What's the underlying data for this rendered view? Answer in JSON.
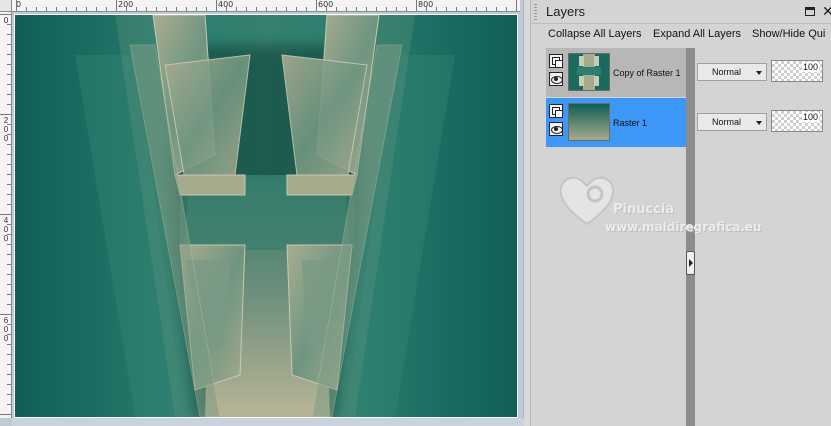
{
  "colors": {
    "teal_dark": "#0f5f55",
    "teal_mid": "#2b7f70",
    "sage": "#a6ab8d",
    "selection_blue": "#3d97f7"
  },
  "rulers": {
    "top_labels": [
      "0",
      "200",
      "400",
      "600",
      "800"
    ],
    "left_labels": [
      "0",
      "2\n0\n0",
      "4\n0\n0",
      "6\n0\n0"
    ]
  },
  "panel": {
    "title": "Layers",
    "window_icon": "window-icon",
    "close_icon": "close-icon",
    "toolbar": {
      "collapse": "Collapse All Layers",
      "expand": "Expand All Layers",
      "show_hide": "Show/Hide Qui"
    }
  },
  "layers": [
    {
      "name": "Copy of Raster 1",
      "blend_mode": "Normal",
      "opacity": "100",
      "selected": false
    },
    {
      "name": "Raster 1",
      "blend_mode": "Normal",
      "opacity": "100",
      "selected": true
    }
  ],
  "watermark": {
    "name": "Pinuccia",
    "site": "www.maldiregrafica.eu"
  }
}
